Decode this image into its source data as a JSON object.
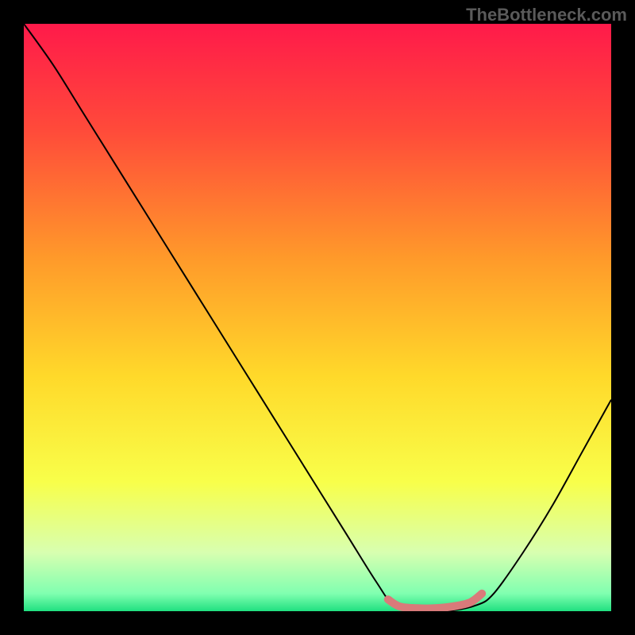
{
  "watermark": "TheBottleneck.com",
  "chart_data": {
    "type": "line",
    "title": "",
    "xlabel": "",
    "ylabel": "",
    "xlim": [
      0,
      100
    ],
    "ylim": [
      0,
      100
    ],
    "series": [
      {
        "name": "bottleneck-curve",
        "x": [
          0,
          5,
          10,
          15,
          20,
          25,
          30,
          35,
          40,
          45,
          50,
          55,
          60,
          63,
          67,
          72,
          77,
          80,
          85,
          90,
          95,
          100
        ],
        "y": [
          100,
          93,
          85,
          77,
          69,
          61,
          53,
          45,
          37,
          29,
          21,
          13,
          5,
          1,
          0,
          0,
          1,
          3,
          10,
          18,
          27,
          36
        ]
      },
      {
        "name": "highlight-segment",
        "x": [
          62,
          64,
          67,
          70,
          73,
          76,
          78
        ],
        "y": [
          2,
          0.8,
          0.5,
          0.5,
          0.8,
          1.5,
          3
        ]
      }
    ],
    "gradient_stops": [
      {
        "offset": 0,
        "color": "#ff1a4a"
      },
      {
        "offset": 18,
        "color": "#ff4a3a"
      },
      {
        "offset": 40,
        "color": "#ff9a2a"
      },
      {
        "offset": 60,
        "color": "#ffd92a"
      },
      {
        "offset": 78,
        "color": "#f8ff4a"
      },
      {
        "offset": 90,
        "color": "#d8ffb0"
      },
      {
        "offset": 97,
        "color": "#80ffb0"
      },
      {
        "offset": 100,
        "color": "#20e080"
      }
    ],
    "highlight_color": "#d97a7a"
  }
}
